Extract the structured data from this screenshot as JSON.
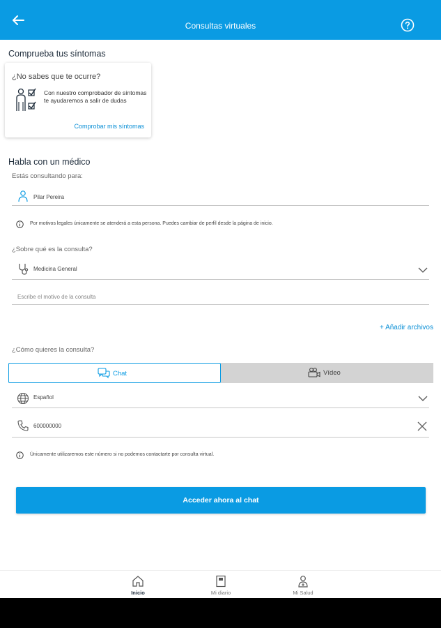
{
  "header": {
    "title": "Consultas virtuales",
    "back_icon": "arrow-left-icon",
    "help_icon": "help-circle-icon"
  },
  "symptoms": {
    "section_title": "Comprueba tus síntomas",
    "card_question": "¿No sabes que te ocurre?",
    "card_description": "Con nuestro comprobador de síntomas te ayudaremos a salir de dudas",
    "card_link": "Comprobar mis síntomas"
  },
  "doctor": {
    "section_title": "Habla con un médico",
    "consulting_for_label": "Estás consultando para:",
    "patient_name": "Pilar Pereira",
    "patient_info": "Por motivos legales únicamente se atenderá a esta persona. Puedes cambiar de perfil desde la página de inicio.",
    "topic_label": "¿Sobre qué es la consulta?",
    "topic_value": "Medicina General",
    "reason_placeholder": "Escribe el motivo de la consulta",
    "attach_label": "+ Añadir archivos",
    "mode_label": "¿Cómo quieres la consulta?",
    "modes": [
      {
        "label": "Chat",
        "selected": true
      },
      {
        "label": "Vídeo",
        "selected": false
      }
    ],
    "language_value": "Español",
    "phone_value": "600000000",
    "phone_info": "Únicamente utilizaremos este número si no podemos contactarte por consulta virtual.",
    "submit_label": "Acceder ahora al chat"
  },
  "bottom_nav": [
    {
      "label": "Inicio",
      "icon": "home-icon",
      "active": true
    },
    {
      "label": "Mi diario",
      "icon": "diary-icon",
      "active": false
    },
    {
      "label": "Mi Salud",
      "icon": "health-profile-icon",
      "active": false
    }
  ],
  "colors": {
    "primary": "#0a9be3",
    "link": "#0a8fd6",
    "segment_inactive": "#d3d3d3"
  }
}
